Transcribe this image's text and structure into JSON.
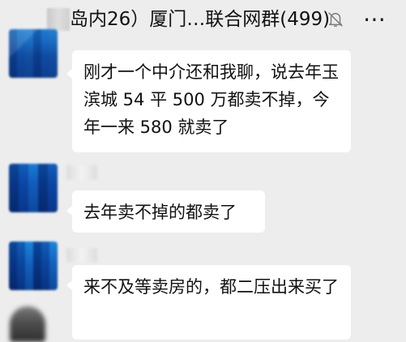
{
  "header": {
    "title": "岛内26）厦门…联合网群(499)",
    "mute_icon": "bell-off-icon",
    "more_icon": "more-dots-icon"
  },
  "messages": [
    {
      "text": "刚才一个中介还和我聊，说去年玉滨城 54 平 500 万都卖不掉，今年一来 580 就卖了"
    },
    {
      "text": "去年卖不掉的都卖了"
    },
    {
      "text": "来不及等卖房的，都二压出来买了"
    }
  ]
}
